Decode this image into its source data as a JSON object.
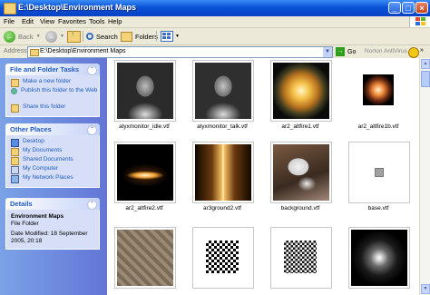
{
  "window": {
    "title": "E:\\Desktop\\Environment Maps",
    "controls": {
      "minimize": "_",
      "maximize": "□",
      "close": "×"
    }
  },
  "menu": [
    "File",
    "Edit",
    "View",
    "Favorites",
    "Tools",
    "Help"
  ],
  "toolbar": {
    "back": "Back",
    "search": "Search",
    "folders": "Folders"
  },
  "address": {
    "label": "Address",
    "path": "E:\\Desktop\\Environment Maps",
    "go": "Go",
    "norton": "Norton AntiVirus"
  },
  "tasks": {
    "title": "File and Folder Tasks",
    "items": [
      {
        "label": "Make a new folder",
        "icon": "new-folder-icon"
      },
      {
        "label": "Publish this folder to the Web",
        "icon": "globe-icon"
      },
      {
        "label": "Share this folder",
        "icon": "share-icon"
      }
    ]
  },
  "places": {
    "title": "Other Places",
    "items": [
      {
        "label": "Desktop",
        "icon": "desktop-icon"
      },
      {
        "label": "My Documents",
        "icon": "folder-icon"
      },
      {
        "label": "Shared Documents",
        "icon": "folder-icon"
      },
      {
        "label": "My Computer",
        "icon": "computer-icon"
      },
      {
        "label": "My Network Places",
        "icon": "network-icon"
      }
    ]
  },
  "details": {
    "title": "Details",
    "name": "Environment Maps",
    "type": "File Folder",
    "modified": "Date Modified: 18 September 2005, 20:18"
  },
  "files": [
    "alyxmonitor_idle.vtf",
    "alyxmonitor_talk.vtf",
    "ar2_altfire1.vtf",
    "ar2_altfire1b.vtf",
    "ar2_altfire2.vtf",
    "ar3ground2.vtf",
    "background.vtf",
    "base.vtf",
    "",
    "",
    "",
    ""
  ]
}
